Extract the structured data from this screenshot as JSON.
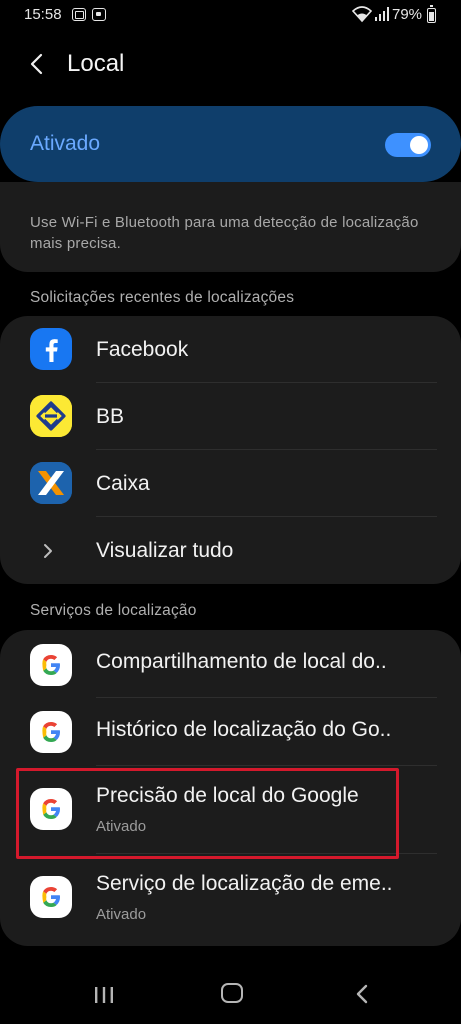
{
  "status_bar": {
    "time": "15:58",
    "battery": "79%",
    "icons": [
      "notification-icon",
      "notification-icon",
      "wifi-icon",
      "signal-icon",
      "battery-icon"
    ]
  },
  "header": {
    "title": "Local",
    "back_icon": "chevron-left-icon"
  },
  "master_toggle": {
    "label": "Ativado",
    "state": "on",
    "accent": "#3e91ff"
  },
  "description": {
    "text": "Use Wi-Fi e Bluetooth para uma detecção de localização mais precisa."
  },
  "recent_requests": {
    "section_label": "Solicitações recentes de localizações",
    "apps": [
      {
        "name": "Facebook",
        "icon": "facebook-icon"
      },
      {
        "name": "BB",
        "icon": "banco-do-brasil-icon"
      },
      {
        "name": "Caixa",
        "icon": "caixa-icon"
      }
    ],
    "view_all": "Visualizar tudo"
  },
  "location_services": {
    "section_label": "Serviços de localização",
    "items": [
      {
        "title": "Compartilhamento de local do..",
        "subtitle": "",
        "icon": "google-icon"
      },
      {
        "title": "Histórico de localização do Go..",
        "subtitle": "",
        "icon": "google-icon"
      },
      {
        "title": "Precisão de local do Google",
        "subtitle": "Ativado",
        "icon": "google-icon",
        "highlighted": true
      },
      {
        "title": "Serviço de localização de eme..",
        "subtitle": "Ativado",
        "icon": "google-icon"
      }
    ],
    "highlight_color": "#d4192c"
  },
  "nav_bar": {
    "icons": [
      "recent-apps-icon",
      "home-icon",
      "back-icon"
    ]
  }
}
